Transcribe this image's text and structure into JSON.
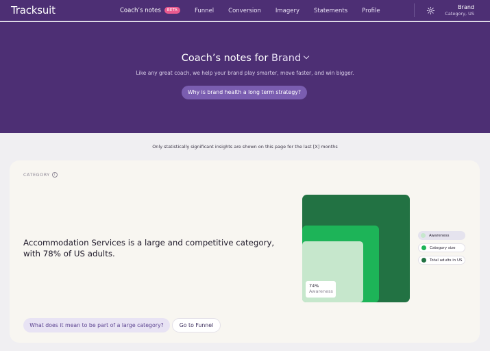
{
  "app": {
    "logo": "Tracksuit"
  },
  "nav": {
    "items": [
      {
        "label": "Coach’s notes",
        "active": true
      },
      {
        "label": "Funnel"
      },
      {
        "label": "Conversion"
      },
      {
        "label": "Imagery"
      },
      {
        "label": "Statements"
      },
      {
        "label": "Profile"
      }
    ],
    "beta_badge": "BETA",
    "settings_icon": "gear-icon",
    "brand": "Brand",
    "brand_sub": "Category, US"
  },
  "hero": {
    "title_prefix": "Coach’s notes for",
    "brand_selector": "Brand",
    "subtitle": "Like any great coach, we help your brand play smarter, move faster, and win bigger.",
    "cta": "Why is brand health a long term strategy?"
  },
  "notice": "Only statistically significant insights are shown on this page for the last [X] months",
  "category_card": {
    "label": "CATEGORY",
    "info_icon": "info-icon",
    "headline": "Accommodation Services is a large and competitive category, with 78% of US adults.",
    "visual": {
      "awareness_value": "74%",
      "awareness_label": "Awareness"
    },
    "legend": [
      {
        "label": "Awareness",
        "color": "#c6e7cc"
      },
      {
        "label": "Category size",
        "color": "#1db458"
      },
      {
        "label": "Total adults in US",
        "color": "#227243"
      }
    ],
    "actions": {
      "learn_more": "What does it mean to be part of a large category?",
      "go_funnel": "Go to Funnel"
    }
  },
  "colors": {
    "header_bg": "#4d2f74",
    "accent": "#7a5db0",
    "beta": "#ea5a8f",
    "page_bg": "#f0eff2",
    "card_bg": "#f8f6f1"
  }
}
